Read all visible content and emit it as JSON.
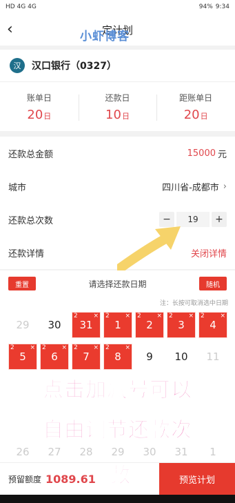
{
  "status_bar": {
    "left": "HD 4G 4G",
    "battery": "94%",
    "time": "9:34"
  },
  "nav": {
    "title": "定计划",
    "watermark": "小虾博客"
  },
  "bank": {
    "name": "汉口银行（0327）",
    "logo_glyph": "汉"
  },
  "days": [
    {
      "label": "账单日",
      "value": "20",
      "unit": "日"
    },
    {
      "label": "还款日",
      "value": "10",
      "unit": "日"
    },
    {
      "label": "距账单日",
      "value": "20",
      "unit": "日"
    }
  ],
  "form": {
    "total_amount_label": "还款总金额",
    "total_amount_value": "15000",
    "total_amount_unit": "元",
    "city_label": "城市",
    "city_value": "四川省-成都市",
    "count_label": "还款总次数",
    "count_value": "19",
    "minus": "−",
    "plus": "+",
    "detail_label": "还款详情",
    "detail_link": "关闭详情"
  },
  "calendar": {
    "reset": "重置",
    "title": "请选择还款日期",
    "random": "随机",
    "note": "注：长按可取消选中日期",
    "row1": [
      "29",
      "30",
      "31",
      "1",
      "2",
      "3",
      "4"
    ],
    "row2": [
      "5",
      "6",
      "7",
      "8",
      "9",
      "10",
      "11"
    ],
    "row3": [
      "26",
      "27",
      "28",
      "29",
      "30",
      "31",
      "1"
    ],
    "badge": "2",
    "remove": "×"
  },
  "overlay": {
    "line1": "点击加减号可以",
    "line2": "自由调节还款次",
    "line3": "数"
  },
  "bottom": {
    "reserve_label": "预留额度",
    "reserve_value": "1089.61",
    "preview_button": "预览计划"
  },
  "colors": {
    "accent": "#e63a2e",
    "overlay_text": "#f06fb4",
    "watermark": "#5b8fd6"
  }
}
